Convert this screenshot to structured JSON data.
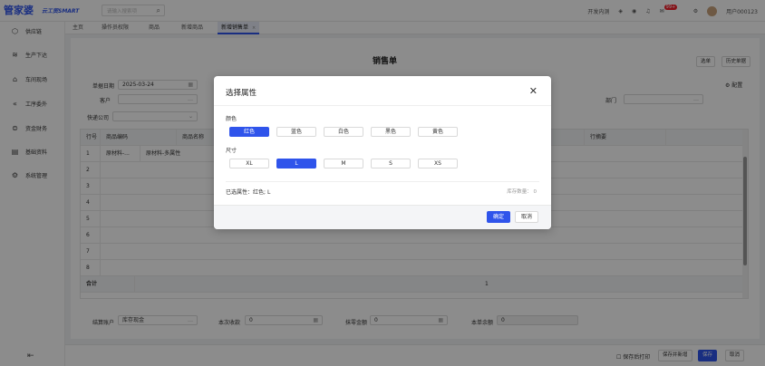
{
  "app": {
    "logo": "管家婆",
    "logo_sub": "云工贸SMART",
    "search_placeholder": "请输入搜索项",
    "top_right": {
      "dev_label": "开发内测",
      "notif_count": "99+",
      "user_name": "用户000123"
    }
  },
  "sidebar": {
    "items": [
      {
        "label": "供应链",
        "icon": "supply-chain-icon"
      },
      {
        "label": "生产下达",
        "icon": "production-icon"
      },
      {
        "label": "车间现场",
        "icon": "workshop-icon"
      },
      {
        "label": "工序委外",
        "icon": "outsourcing-icon"
      },
      {
        "label": "资金财务",
        "icon": "finance-icon"
      },
      {
        "label": "基础资料",
        "icon": "basic-data-icon"
      },
      {
        "label": "系统管理",
        "icon": "system-icon"
      }
    ]
  },
  "tabs": [
    "主页",
    "操作员权限",
    "商品",
    "新增商品",
    "新增销售单"
  ],
  "page": {
    "title": "销售单",
    "btn_select": "选单",
    "btn_history": "历史单据",
    "btn_config": "配置",
    "date_label": "单据日期",
    "date_value": "2025-03-24",
    "customer_label": "客户",
    "dept_label": "部门",
    "express_label": "快递公司"
  },
  "table": {
    "headers": [
      "行号",
      "商品编码",
      "商品名称",
      "行摘要"
    ],
    "rows": [
      {
        "no": "1",
        "code": "原材料-...",
        "name": "原材料-多属性"
      },
      {
        "no": "2",
        "code": "",
        "name": ""
      },
      {
        "no": "3",
        "code": "",
        "name": ""
      },
      {
        "no": "4",
        "code": "",
        "name": ""
      },
      {
        "no": "5",
        "code": "",
        "name": ""
      },
      {
        "no": "6",
        "code": "",
        "name": ""
      },
      {
        "no": "7",
        "code": "",
        "name": ""
      },
      {
        "no": "8",
        "code": "",
        "name": ""
      }
    ],
    "total_label": "合计",
    "total_qty": "1"
  },
  "footer_fields": {
    "account_label": "结算账户",
    "account_value": "库存现金",
    "received_label": "本次收款",
    "received_value": "0",
    "discount_label": "抹零金额",
    "discount_value": "0",
    "balance_label": "本单余额",
    "balance_value": "0"
  },
  "bottom_bar": {
    "print_after_save": "保存后打印",
    "save_new": "保存并新增",
    "save": "保存",
    "cancel": "取消"
  },
  "modal": {
    "title": "选择属性",
    "color_label": "颜色",
    "colors": [
      "红色",
      "蓝色",
      "白色",
      "黑色",
      "黄色"
    ],
    "selected_color_index": 0,
    "size_label": "尺寸",
    "sizes": [
      "XL",
      "L",
      "M",
      "S",
      "XS"
    ],
    "selected_size_index": 1,
    "selected_prefix": "已选属性：",
    "selected_value": "红色; L",
    "stock_label": "库存数量：",
    "stock_value": "0",
    "confirm": "确定",
    "cancel": "取消"
  },
  "colors": {
    "accent": "#2f54eb",
    "overlay": "rgba(0,0,0,0.45)"
  }
}
